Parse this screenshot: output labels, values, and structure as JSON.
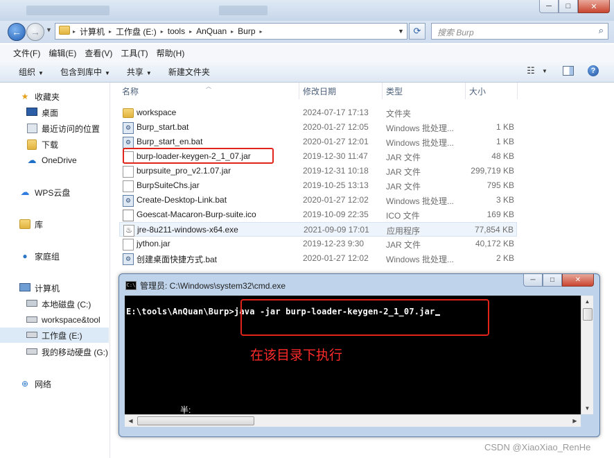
{
  "window": {
    "minimize": "─",
    "maximize": "□",
    "close": "✕"
  },
  "address": {
    "crumbs": [
      "计算机",
      "工作盘 (E:)",
      "tools",
      "AnQuan",
      "Burp"
    ],
    "search_placeholder": "搜索 Burp"
  },
  "menu": [
    "文件(F)",
    "编辑(E)",
    "查看(V)",
    "工具(T)",
    "帮助(H)"
  ],
  "commands": [
    "组织",
    "包含到库中",
    "共享",
    "新建文件夹"
  ],
  "sidebar": {
    "favorites": "收藏夹",
    "desktop": "桌面",
    "recent": "最近访问的位置",
    "downloads": "下载",
    "onedrive": "OneDrive",
    "wps": "WPS云盘",
    "library": "库",
    "homegroup": "家庭组",
    "computer": "计算机",
    "drive_c": "本地磁盘 (C:)",
    "drive_ws": "workspace&tool",
    "drive_e": "工作盘 (E:)",
    "drive_g": "我的移动硬盘 (G:)",
    "network": "网络"
  },
  "columns": {
    "name": "名称",
    "modified": "修改日期",
    "type": "类型",
    "size": "大小"
  },
  "files": [
    {
      "name": "workspace",
      "date": "2024-07-17 17:13",
      "type": "文件夹",
      "size": "",
      "icon": "folder"
    },
    {
      "name": "Burp_start.bat",
      "date": "2020-01-27 12:05",
      "type": "Windows 批处理...",
      "size": "1 KB",
      "icon": "bat"
    },
    {
      "name": "Burp_start_en.bat",
      "date": "2020-01-27 12:01",
      "type": "Windows 批处理...",
      "size": "1 KB",
      "icon": "bat"
    },
    {
      "name": "burp-loader-keygen-2_1_07.jar",
      "date": "2019-12-30 11:47",
      "type": "JAR 文件",
      "size": "48 KB",
      "icon": "jar"
    },
    {
      "name": "burpsuite_pro_v2.1.07.jar",
      "date": "2019-12-31 10:18",
      "type": "JAR 文件",
      "size": "299,719 KB",
      "icon": "jar"
    },
    {
      "name": "BurpSuiteChs.jar",
      "date": "2019-10-25 13:13",
      "type": "JAR 文件",
      "size": "795 KB",
      "icon": "jar"
    },
    {
      "name": "Create-Desktop-Link.bat",
      "date": "2020-01-27 12:02",
      "type": "Windows 批处理...",
      "size": "3 KB",
      "icon": "bat"
    },
    {
      "name": "Goescat-Macaron-Burp-suite.ico",
      "date": "2019-10-09 22:35",
      "type": "ICO 文件",
      "size": "169 KB",
      "icon": "doc"
    },
    {
      "name": "jre-8u211-windows-x64.exe",
      "date": "2021-09-09 17:01",
      "type": "应用程序",
      "size": "77,854 KB",
      "icon": "exe"
    },
    {
      "name": "jython.jar",
      "date": "2019-12-23 9:30",
      "type": "JAR 文件",
      "size": "40,172 KB",
      "icon": "jar"
    },
    {
      "name": "创建桌面快捷方式.bat",
      "date": "2020-01-27 12:02",
      "type": "Windows 批处理...",
      "size": "2 KB",
      "icon": "bat"
    }
  ],
  "cmd": {
    "title": "管理员: C:\\Windows\\system32\\cmd.exe",
    "prompt": "E:\\tools\\AnQuan\\Burp>",
    "command": "java -jar burp-loader-keygen-2_1_07.jar",
    "note": "在该目录下执行",
    "ime": "半:"
  },
  "watermark": "CSDN @XiaoXiao_RenHe",
  "colors": {
    "highlight_box": "#e2231a",
    "note_text": "#ff2a2a"
  }
}
